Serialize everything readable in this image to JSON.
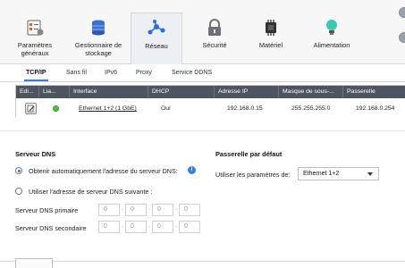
{
  "toolbar": {
    "items": [
      {
        "label": "Paramètres\ngénéraux",
        "icon": "settings-checklist-icon"
      },
      {
        "label": "Gestionnaire de\nstockage",
        "icon": "database-icon"
      },
      {
        "label": "Réseau",
        "icon": "network-icon"
      },
      {
        "label": "Sécurité",
        "icon": "lock-icon"
      },
      {
        "label": "Matériel",
        "icon": "chip-icon"
      },
      {
        "label": "Alimentation",
        "icon": "lightbulb-icon"
      }
    ]
  },
  "tabs": [
    "TCP/IP",
    "Sans fil",
    "IPv6",
    "Proxy",
    "Service DDNS"
  ],
  "table": {
    "headers": [
      "Edi...",
      "Lia...",
      "Interface",
      "DHCP",
      "Adresse IP",
      "Masque de sous-...",
      "Passerelle"
    ],
    "rows": [
      {
        "interface": "Ethernet 1+2 (1 GbE)",
        "dhcp": "Oui",
        "ip": "192.168.0.15",
        "mask": "255.255.255.0",
        "gateway": "192.168.0.254"
      }
    ]
  },
  "dns": {
    "title": "Serveur DNS",
    "auto_label": "Obtenir automatiquement l'adresse du serveur DNS:",
    "manual_label": "Utiliser l'adresse de serveur DNS suivante :",
    "primary_label": "Serveur DNS primaire",
    "secondary_label": "Serveur DNS secondaire",
    "primary": [
      "0",
      "0",
      "0",
      "0"
    ],
    "secondary": [
      "0",
      "0",
      "0",
      "0"
    ]
  },
  "gateway": {
    "title": "Passerelle par défaut",
    "use_label": "Utiliser les paramètres de:",
    "selected": "Ethernet 1+2"
  },
  "colors": {
    "accent": "#3a7bd5",
    "header": "#4c5560",
    "link_ok": "#4fbf3a"
  }
}
